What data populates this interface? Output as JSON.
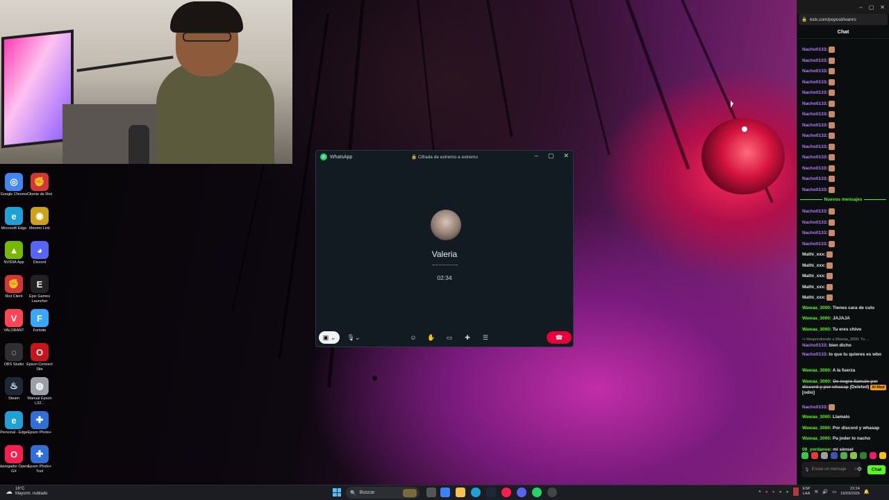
{
  "colors": {
    "kick_green": "#53fc18",
    "whatsapp_green": "#25d366",
    "end_call_red": "#ea0038",
    "purple_user": "#b57bff"
  },
  "desktop_icons": [
    {
      "label": "Google Chrome",
      "icon": "chrome-icon",
      "color": "#4285f4"
    },
    {
      "label": "Cliente de Riot",
      "icon": "riot-client-icon",
      "color": "#d13639"
    },
    {
      "label": "Microsoft Edge",
      "icon": "edge-icon",
      "color": "#1fa1d6"
    },
    {
      "label": "Meomo Link",
      "icon": "meomo-link-icon",
      "color": "#caa21e"
    },
    {
      "label": "NVIDIA App",
      "icon": "nvidia-icon",
      "color": "#76b900"
    },
    {
      "label": "Discord",
      "icon": "discord-icon",
      "color": "#5865f2"
    },
    {
      "label": "Riot Client",
      "icon": "riot-client-icon",
      "color": "#d13639"
    },
    {
      "label": "Epic Games Launcher",
      "icon": "epic-games-icon",
      "color": "#222222"
    },
    {
      "label": "VALORANT",
      "icon": "valorant-icon",
      "color": "#fd4556"
    },
    {
      "label": "Fortnite",
      "icon": "fortnite-icon",
      "color": "#3aa6f7"
    },
    {
      "label": "OBS Studio",
      "icon": "obs-icon",
      "color": "#302e31"
    },
    {
      "label": "Epson Connect Site",
      "icon": "opera-icon",
      "color": "#c4161c"
    },
    {
      "label": "Steam",
      "icon": "steam-icon",
      "color": "#1b2838"
    },
    {
      "label": "Manual Epson L32...",
      "icon": "manual-icon",
      "color": "#9aa0a6"
    },
    {
      "label": "Personal - Edge",
      "icon": "edge-icon",
      "color": "#1fa1d6"
    },
    {
      "label": "Epson Photo+",
      "icon": "epson-photo-icon",
      "color": "#2f6fd6"
    },
    {
      "label": "Navegador Opera GX",
      "icon": "opera-gx-icon",
      "color": "#fa1e4e"
    },
    {
      "label": "Epson Photo+ Tool",
      "icon": "epson-photo-tool-icon",
      "color": "#2f6fd6"
    }
  ],
  "whatsapp": {
    "app_name": "WhatsApp",
    "encryption": "Cifrada de extremo a extremo",
    "contact_name": "Valeria",
    "call_time": "02:34",
    "controls": [
      "video-off-icon",
      "mic-icon",
      "emoji-icon",
      "raise-hand-icon",
      "screen-share-icon",
      "add-participant-icon",
      "more-icon",
      "end-call-icon"
    ]
  },
  "chat": {
    "url": "kick.com/popout/ivanro",
    "title": "Chat",
    "new_messages_label": "Nuevos mensajes",
    "input_placeholder": "Enviar un mensaje",
    "send_label": "Chat",
    "messages": [
      {
        "user": "Nacho0133",
        "text": "",
        "color": "#b57bff",
        "emote": true
      },
      {
        "user": "Nacho0133",
        "text": "",
        "color": "#b57bff",
        "emote": true
      },
      {
        "user": "Nacho0133",
        "text": "",
        "color": "#b57bff",
        "emote": true
      },
      {
        "user": "Nacho0133",
        "text": "",
        "color": "#b57bff",
        "emote": true
      },
      {
        "user": "Nacho0133",
        "text": "",
        "color": "#b57bff",
        "emote": true
      },
      {
        "user": "Nacho0133",
        "text": "",
        "color": "#b57bff",
        "emote": true
      },
      {
        "user": "Nacho0133",
        "text": "",
        "color": "#b57bff",
        "emote": true
      },
      {
        "user": "Nacho0133",
        "text": "",
        "color": "#b57bff",
        "emote": true
      },
      {
        "user": "Nacho0133",
        "text": "",
        "color": "#b57bff",
        "emote": true
      },
      {
        "user": "Nacho0133",
        "text": "",
        "color": "#b57bff",
        "emote": true
      },
      {
        "user": "Nacho0133",
        "text": "",
        "color": "#b57bff",
        "emote": true
      },
      {
        "user": "Nacho0133",
        "text": "",
        "color": "#b57bff",
        "emote": true
      },
      {
        "user": "Nacho0133",
        "text": "",
        "color": "#b57bff",
        "emote": true
      },
      {
        "user": "Nacho0133",
        "text": "",
        "color": "#b57bff",
        "emote": true
      }
    ],
    "new_messages": [
      {
        "user": "Nacho0133",
        "text": "",
        "color": "#b57bff",
        "emote": true
      },
      {
        "user": "Nacho0133",
        "text": "",
        "color": "#b57bff",
        "emote": true
      },
      {
        "user": "Nacho0133",
        "text": "",
        "color": "#b57bff",
        "emote": true
      },
      {
        "user": "Nacho0133",
        "text": "",
        "color": "#b57bff",
        "emote": true
      },
      {
        "user": "Mathi_xxx",
        "text": "",
        "color": "#e8e8e8",
        "emote": true
      },
      {
        "user": "Mathi_xxx",
        "text": "",
        "color": "#e8e8e8",
        "emote": true
      },
      {
        "user": "Mathi_xxx",
        "text": "",
        "color": "#e8e8e8",
        "emote": true
      },
      {
        "user": "Mathi_xxx",
        "text": "",
        "color": "#e8e8e8",
        "emote": true
      },
      {
        "user": "Mathi_xxx",
        "text": "",
        "color": "#e8e8e8",
        "emote": true
      },
      {
        "user": "Wawaa_3000",
        "text": "Tienes cara de culo",
        "color": "#53fc18",
        "emote": false
      },
      {
        "user": "Wawaa_3000",
        "text": "JAJAJA",
        "color": "#53fc18",
        "emote": false
      },
      {
        "user": "Wawaa_3000",
        "text": "Tu eres chivo",
        "color": "#53fc18",
        "emote": false
      }
    ],
    "reply_note": "Respondiendo a Wawaa_3000: Tu ...",
    "later_messages": [
      {
        "user": "Nacho0133",
        "text": "bien dicho",
        "color": "#b57bff"
      },
      {
        "user": "Nacho0133",
        "text": "lo que tu quieres es wbo",
        "color": "#b57bff"
      },
      {
        "user": "Wawaa_3000",
        "text": "A la fuerza",
        "color": "#53fc18"
      }
    ],
    "deleted": {
      "user": "Wawaa_3000",
      "text": "Oe negro llamalo por discord y por whasap",
      "deleted_label": "(Deleted)",
      "tag": "AI Mod",
      "tag_note": "[odio]"
    },
    "final_messages": [
      {
        "user": "Nacho0133",
        "text": "",
        "color": "#b57bff",
        "emote": true
      },
      {
        "user": "Wawaa_3000",
        "text": "Llamalo",
        "color": "#53fc18",
        "emote": false
      },
      {
        "user": "Wawaa_3000",
        "text": "Por discord y whasap",
        "color": "#53fc18",
        "emote": false
      },
      {
        "user": "Wawaa_3000",
        "text": "Pa joder lo nacho",
        "color": "#53fc18",
        "emote": false
      },
      {
        "user": "08_yordanoe",
        "text": "mi sènsei",
        "color": "#53fc18",
        "emote": false
      }
    ]
  },
  "taskbar": {
    "weather_temp": "16°C",
    "weather_desc": "Mayorm. nublado",
    "search_placeholder": "Buscar",
    "lang_1": "ESP",
    "lang_2": "LAA",
    "time": "22:24",
    "date": "16/03/2026"
  }
}
